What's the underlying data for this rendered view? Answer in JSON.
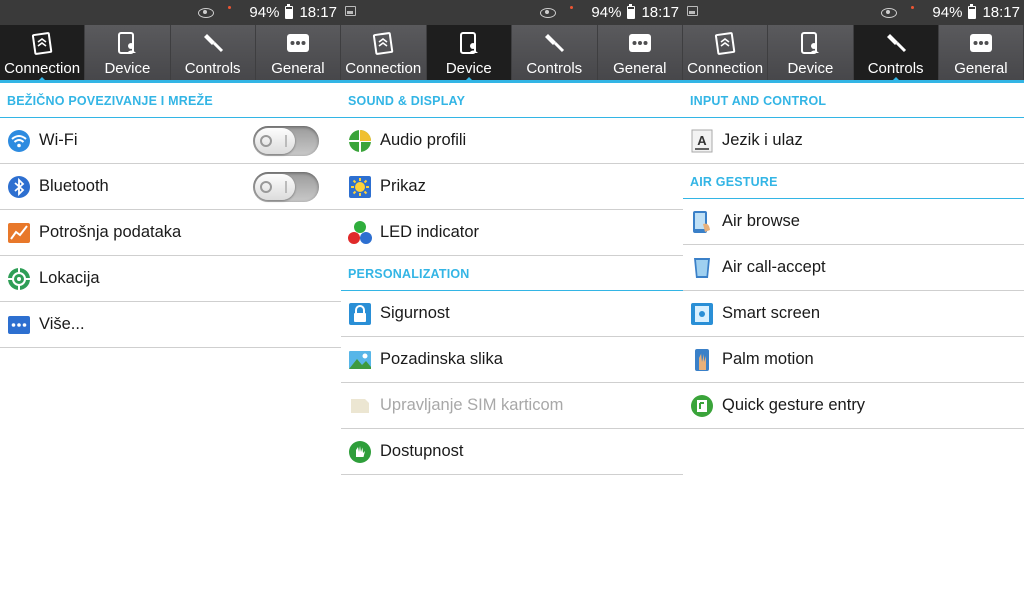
{
  "status_bar": {
    "battery": "94%",
    "time": "18:17"
  },
  "tabs": [
    "Connection",
    "Device",
    "Controls",
    "General"
  ],
  "accent": "#33b5e5",
  "panels": [
    {
      "active_tab": "Connection",
      "sections": [
        {
          "title": "BEŽIČNO POVEZIVANJE I MREŽE",
          "items": [
            {
              "label": "Wi-Fi",
              "icon": "wifi-icon",
              "toggle": "off"
            },
            {
              "label": "Bluetooth",
              "icon": "bluetooth-icon",
              "toggle": "off"
            },
            {
              "label": "Potrošnja podataka",
              "icon": "data-usage-icon"
            },
            {
              "label": "Lokacija",
              "icon": "location-icon"
            },
            {
              "label": "Više...",
              "icon": "more-icon"
            }
          ]
        }
      ]
    },
    {
      "active_tab": "Device",
      "sections": [
        {
          "title": "SOUND & DISPLAY",
          "items": [
            {
              "label": "Audio profili",
              "icon": "audio-profile-icon"
            },
            {
              "label": "Prikaz",
              "icon": "display-icon"
            },
            {
              "label": "LED indicator",
              "icon": "led-indicator-icon"
            }
          ]
        },
        {
          "title": "PERSONALIZATION",
          "items": [
            {
              "label": "Sigurnost",
              "icon": "lock-icon"
            },
            {
              "label": "Pozadinska slika",
              "icon": "wallpaper-icon"
            },
            {
              "label": "Upravljanje SIM karticom",
              "icon": "sim-card-icon",
              "disabled": true
            },
            {
              "label": "Dostupnost",
              "icon": "accessibility-icon"
            }
          ]
        }
      ]
    },
    {
      "active_tab": "Controls",
      "sections": [
        {
          "title": "INPUT AND CONTROL",
          "items": [
            {
              "label": "Jezik i ulaz",
              "icon": "language-input-icon"
            }
          ]
        },
        {
          "title": "AIR GESTURE",
          "items": [
            {
              "label": "Air browse",
              "icon": "air-browse-icon"
            },
            {
              "label": "Air call-accept",
              "icon": "air-call-accept-icon"
            },
            {
              "label": "Smart screen",
              "icon": "smart-screen-icon"
            },
            {
              "label": "Palm motion",
              "icon": "palm-motion-icon"
            },
            {
              "label": "Quick gesture entry",
              "icon": "quick-gesture-icon"
            }
          ]
        }
      ]
    }
  ]
}
